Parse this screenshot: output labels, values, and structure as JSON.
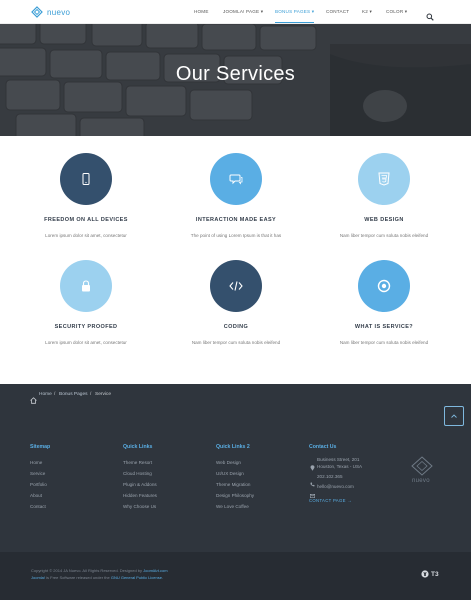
{
  "header": {
    "logo_text": "nuevo",
    "nav": [
      {
        "label": "HOME"
      },
      {
        "label": "JOOMLA! PAGE ▾"
      },
      {
        "label": "BONUS PAGES ▾"
      },
      {
        "label": "CONTACT"
      },
      {
        "label": "K2 ▾"
      },
      {
        "label": "COLOR ▾"
      }
    ],
    "active_index": 2
  },
  "hero": {
    "title": "Our Services"
  },
  "services": [
    {
      "title": "FREEDOM ON ALL DEVICES",
      "desc": "Lorem ipsum dolor sit amet, consectetur",
      "icon": "mobile-icon",
      "color": "#34506d"
    },
    {
      "title": "INTERACTION MADE EASY",
      "desc": "The point of using Lorem Ipsum is that it has",
      "icon": "chat-icon",
      "color": "#5aaee4"
    },
    {
      "title": "WEB DESIGN",
      "desc": "Nam liber tempor cum soluta nobis eleifend",
      "icon": "css3-icon",
      "color": "#9cd1ef"
    },
    {
      "title": "SECURITY PROOFED",
      "desc": "Lorem ipsum dolor sit amet, consectetur",
      "icon": "lock-icon",
      "color": "#9cd1ef"
    },
    {
      "title": "CODING",
      "desc": "Nam liber tempor cum soluta nobis eleifend",
      "icon": "code-icon",
      "color": "#34506d"
    },
    {
      "title": "WHAT IS SERVICE?",
      "desc": "Nam liber tempor cum soluta nobis eleifend",
      "icon": "target-icon",
      "color": "#5aaee4"
    }
  ],
  "breadcrumb": {
    "home": "Home",
    "sep": "/",
    "parent": "Bonus Pages",
    "current": "Service"
  },
  "footer": {
    "sitemap": {
      "title": "Sitemap",
      "links": [
        "Home",
        "Service",
        "Portfolio",
        "About",
        "Contact"
      ]
    },
    "quick_links": {
      "title": "Quick Links",
      "links": [
        "Theme Resort",
        "Cloud Hosting",
        "Plugin & Addons",
        "Hidden Features",
        "Why Choose Us"
      ]
    },
    "quick_links_2": {
      "title": "Quick Links 2",
      "links": [
        "Web Design",
        "UI/UX Design",
        "Theme Migration",
        "Design Philosophy",
        "We Love Coffee"
      ]
    },
    "contact": {
      "title": "Contact Us",
      "address_line1": "Business Street, 201",
      "address_line2": "Houston, Texas - USA",
      "phone": "202.102.365",
      "email": "hello@nuevo.com",
      "page_link": "CONTACT PAGE  →"
    },
    "logo_text": "nuevo"
  },
  "bottom": {
    "copy_line1_prefix": "Copyright © 2014 JA Nuevo. All Rights Reserved. Designed by ",
    "copy_line1_link": "JoomlArt.com",
    "copy_line2_link1": "Joomla!",
    "copy_line2_mid": " is Free Software released under the ",
    "copy_line2_link2": "GNU General Public License.",
    "t3_label": "T3"
  }
}
